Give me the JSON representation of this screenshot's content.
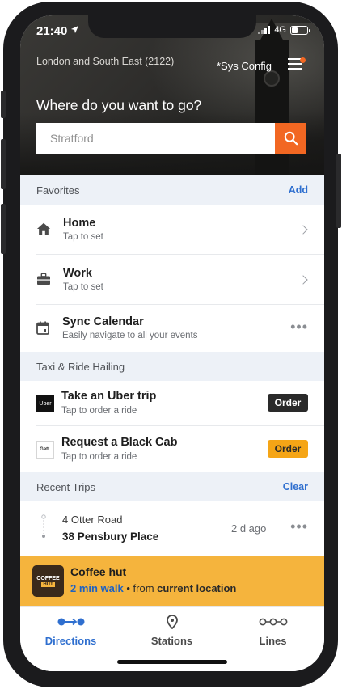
{
  "status": {
    "time": "21:40",
    "network": "4G"
  },
  "header": {
    "region": "London and South East (2122)",
    "sys_config": "*Sys Config",
    "prompt": "Where do you want to go?",
    "search_placeholder": "Stratford"
  },
  "favorites": {
    "title": "Favorites",
    "action": "Add",
    "items": [
      {
        "title": "Home",
        "subtitle": "Tap to set",
        "icon": "home-icon"
      },
      {
        "title": "Work",
        "subtitle": "Tap to set",
        "icon": "briefcase-icon"
      },
      {
        "title": "Sync Calendar",
        "subtitle": "Easily navigate to all your events",
        "icon": "calendar-icon"
      }
    ]
  },
  "taxi": {
    "title": "Taxi & Ride Hailing",
    "items": [
      {
        "title": "Take an Uber trip",
        "subtitle": "Tap to order a ride",
        "button": "Order",
        "logo": "Uber"
      },
      {
        "title": "Request a Black Cab",
        "subtitle": "Tap to order a ride",
        "button": "Order",
        "logo": "Gett."
      }
    ]
  },
  "recent": {
    "title": "Recent Trips",
    "action": "Clear",
    "trip": {
      "from": "4 Otter Road",
      "to": "38 Pensbury Place",
      "when": "2 d ago"
    }
  },
  "promo": {
    "logo_top": "COFFEE",
    "logo_bottom": "HUT",
    "title": "Coffee hut",
    "walk": "2 min walk",
    "middle": " • from ",
    "location": "current location"
  },
  "tabs": [
    {
      "label": "Directions",
      "icon": "directions-icon",
      "active": true
    },
    {
      "label": "Stations",
      "icon": "location-pin-icon",
      "active": false
    },
    {
      "label": "Lines",
      "icon": "lines-icon",
      "active": false
    }
  ],
  "colors": {
    "accent": "#f26722",
    "link": "#2f6fcf",
    "promo": "#f5b43d",
    "order_amber": "#f5a516"
  }
}
